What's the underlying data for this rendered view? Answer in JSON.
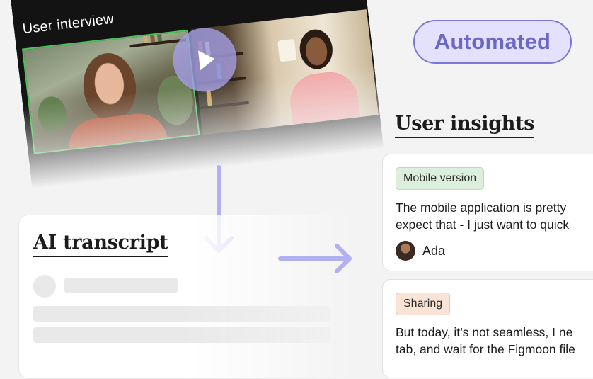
{
  "video": {
    "title": "User interview",
    "play_icon": "play-icon"
  },
  "transcript": {
    "heading": "AI transcript"
  },
  "automated": {
    "label": "Automated"
  },
  "insights": {
    "heading": "User insights",
    "cards": [
      {
        "tag": "Mobile version",
        "tag_color": "#dcefdc",
        "text_line1": "The mobile application is pretty",
        "text_line2": "expect that - I just want to quick",
        "author": "Ada"
      },
      {
        "tag": "Sharing",
        "tag_color": "#fbe3d6",
        "text_line1": "But today, it’s not seamless, I ne",
        "text_line2": "tab, and wait for the Figmoon file"
      }
    ]
  },
  "colors": {
    "accent": "#7c77d6",
    "accent_light": "#e3e1fb",
    "arrow": "#b3b0f0",
    "background": "#f3f3f3"
  }
}
